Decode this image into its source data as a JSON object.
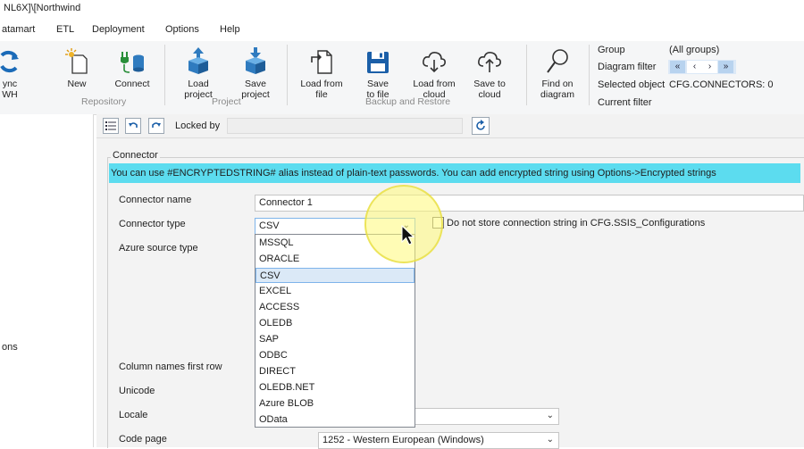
{
  "window": {
    "title": "NL6X]\\[Northwind"
  },
  "menu": [
    {
      "key": "datamart",
      "label": "atamart"
    },
    {
      "key": "etl",
      "label": "ETL"
    },
    {
      "key": "deployment",
      "label": "Deployment"
    },
    {
      "key": "options",
      "label": "Options"
    },
    {
      "key": "help",
      "label": "Help"
    }
  ],
  "ribbon": {
    "sync": {
      "label": "ync\nWH"
    },
    "new": {
      "label": "New"
    },
    "connect": {
      "label": "Connect"
    },
    "load_project": {
      "label": "Load\nproject"
    },
    "save_project": {
      "label": "Save\nproject"
    },
    "load_from_file": {
      "label": "Load from\nfile"
    },
    "save_to_file": {
      "label": "Save\nto file"
    },
    "load_from_cloud": {
      "label": "Load from\ncloud"
    },
    "save_to_cloud": {
      "label": "Save to\ncloud"
    },
    "find_on_diagram": {
      "label": "Find on\ndiagram"
    },
    "groups": {
      "repository": "Repository",
      "project": "Project",
      "backup": "Backup and Restore"
    },
    "filter": {
      "group_label": "Group",
      "group_value": "(All groups)",
      "diagram_filter_label": "Diagram filter",
      "selected_object_label": "Selected object",
      "selected_object_value": "CFG.CONNECTORS: 0",
      "current_filter_label": "Current filter",
      "nav": [
        "«",
        "‹",
        "›",
        "»"
      ]
    }
  },
  "left_panel": {
    "partial_text": "ons"
  },
  "toolbar": {
    "locked_by_label": "Locked by",
    "locked_by_value": ""
  },
  "connector": {
    "section_title": "Connector",
    "banner": "You can use #ENCRYPTEDSTRING# alias instead of plain-text passwords. You can add encrypted string using Options->Encrypted strings",
    "name_label": "Connector name",
    "name_value": "Connector 1",
    "type_label": "Connector type",
    "type_value": "CSV",
    "no_store_label": "Do not store connection string in CFG.SSIS_Configurations",
    "azure_label": "Azure source type",
    "colnames_label": "Column names first row",
    "unicode_label": "Unicode",
    "locale_label": "Locale",
    "codepage_label": "Code page",
    "codepage_value": "1252 - Western European (Windows)",
    "type_options": [
      "MSSQL",
      "ORACLE",
      "CSV",
      "EXCEL",
      "ACCESS",
      "OLEDB",
      "SAP",
      "ODBC",
      "DIRECT",
      "OLEDB.NET",
      "Azure BLOB",
      "OData"
    ],
    "selected_index": 2
  },
  "colors": {
    "banner": "#5cdcef",
    "accent": "#1b6bb8",
    "selection": "#dbe9f7"
  }
}
